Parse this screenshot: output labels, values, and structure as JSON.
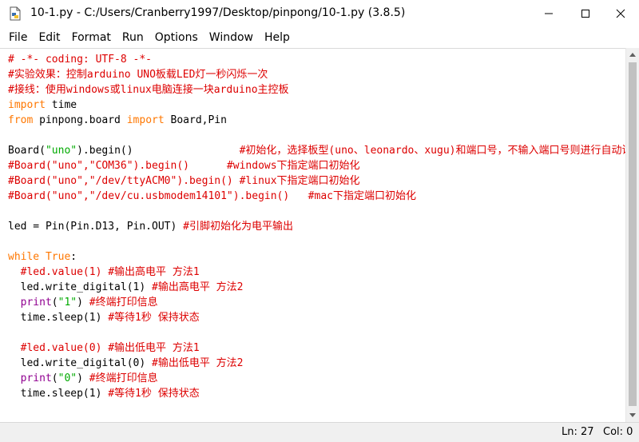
{
  "window": {
    "title": "10-1.py - C:/Users/Cranberry1997/Desktop/pinpong/10-1.py (3.8.5)",
    "icon": "python-file-icon"
  },
  "menu": [
    "File",
    "Edit",
    "Format",
    "Run",
    "Options",
    "Window",
    "Help"
  ],
  "colors": {
    "comment": "#dd0000",
    "keyword": "#ff7700",
    "string": "#00aa00",
    "builtin": "#900090",
    "plain": "#000000"
  },
  "code_lines": [
    [
      {
        "t": "# -*- coding: UTF-8 -*-",
        "c": "comment"
      }
    ],
    [
      {
        "t": "#实验效果：控制arduino UNO板载LED灯一秒闪烁一次",
        "c": "comment"
      }
    ],
    [
      {
        "t": "#接线：使用windows或linux电脑连接一块arduino主控板",
        "c": "comment"
      }
    ],
    [
      {
        "t": "import",
        "c": "keyword"
      },
      {
        "t": " time",
        "c": "plain"
      }
    ],
    [
      {
        "t": "from",
        "c": "keyword"
      },
      {
        "t": " pinpong.board ",
        "c": "plain"
      },
      {
        "t": "import",
        "c": "keyword"
      },
      {
        "t": " Board,Pin",
        "c": "plain"
      }
    ],
    [],
    [
      {
        "t": "Board(",
        "c": "plain"
      },
      {
        "t": "\"uno\"",
        "c": "string"
      },
      {
        "t": ").begin()                 ",
        "c": "plain"
      },
      {
        "t": "#初始化，选择板型(uno、leonardo、xugu)和端口号，不输入端口号则进行自动识别",
        "c": "comment"
      }
    ],
    [
      {
        "t": "#Board(\"uno\",\"COM36\").begin()      #windows下指定端口初始化",
        "c": "comment"
      }
    ],
    [
      {
        "t": "#Board(\"uno\",\"/dev/ttyACM0\").begin() #linux下指定端口初始化",
        "c": "comment"
      }
    ],
    [
      {
        "t": "#Board(\"uno\",\"/dev/cu.usbmodem14101\").begin()   #mac下指定端口初始化",
        "c": "comment"
      }
    ],
    [],
    [
      {
        "t": "led = Pin(Pin.D13, Pin.OUT) ",
        "c": "plain"
      },
      {
        "t": "#引脚初始化为电平输出",
        "c": "comment"
      }
    ],
    [],
    [
      {
        "t": "while",
        "c": "keyword"
      },
      {
        "t": " ",
        "c": "plain"
      },
      {
        "t": "True",
        "c": "keyword"
      },
      {
        "t": ":",
        "c": "plain"
      }
    ],
    [
      {
        "t": "  ",
        "c": "plain"
      },
      {
        "t": "#led.value(1) #输出高电平 方法1",
        "c": "comment"
      }
    ],
    [
      {
        "t": "  led.write_digital(1) ",
        "c": "plain"
      },
      {
        "t": "#输出高电平 方法2",
        "c": "comment"
      }
    ],
    [
      {
        "t": "  ",
        "c": "plain"
      },
      {
        "t": "print",
        "c": "builtin"
      },
      {
        "t": "(",
        "c": "plain"
      },
      {
        "t": "\"1\"",
        "c": "string"
      },
      {
        "t": ") ",
        "c": "plain"
      },
      {
        "t": "#终端打印信息",
        "c": "comment"
      }
    ],
    [
      {
        "t": "  time.sleep(1) ",
        "c": "plain"
      },
      {
        "t": "#等待1秒 保持状态",
        "c": "comment"
      }
    ],
    [],
    [
      {
        "t": "  ",
        "c": "plain"
      },
      {
        "t": "#led.value(0) #输出低电平 方法1",
        "c": "comment"
      }
    ],
    [
      {
        "t": "  led.write_digital(0) ",
        "c": "plain"
      },
      {
        "t": "#输出低电平 方法2",
        "c": "comment"
      }
    ],
    [
      {
        "t": "  ",
        "c": "plain"
      },
      {
        "t": "print",
        "c": "builtin"
      },
      {
        "t": "(",
        "c": "plain"
      },
      {
        "t": "\"0\"",
        "c": "string"
      },
      {
        "t": ") ",
        "c": "plain"
      },
      {
        "t": "#终端打印信息",
        "c": "comment"
      }
    ],
    [
      {
        "t": "  time.sleep(1) ",
        "c": "plain"
      },
      {
        "t": "#等待1秒 保持状态",
        "c": "comment"
      }
    ]
  ],
  "status": {
    "line": "Ln: 27",
    "col": "Col: 0"
  }
}
